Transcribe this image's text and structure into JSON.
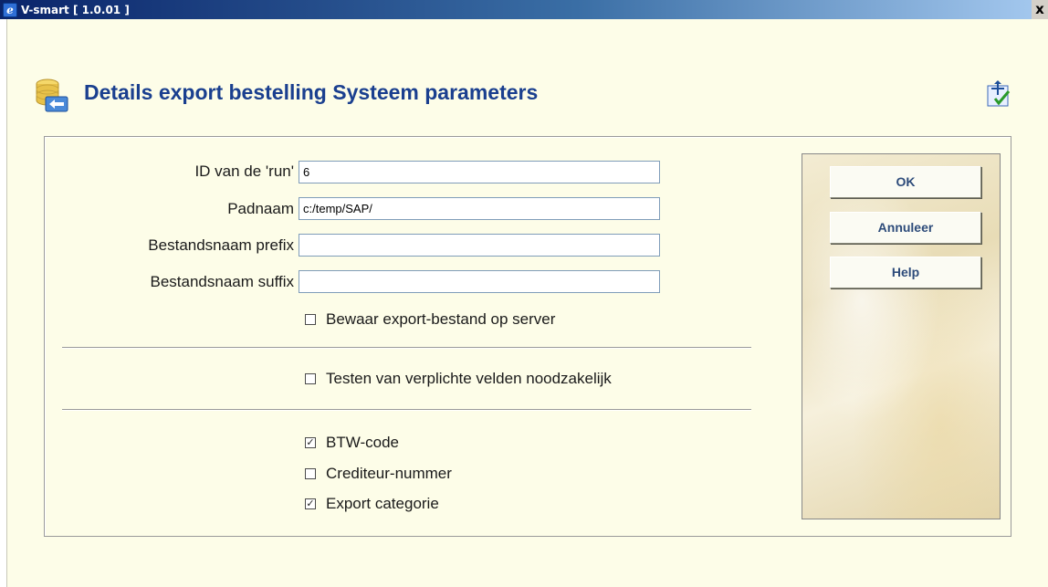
{
  "window": {
    "title": "V-smart [ 1.0.01 ]",
    "close_label": "x"
  },
  "header": {
    "title": "Details export bestelling Systeem parameters"
  },
  "form": {
    "fields": [
      {
        "label": "ID van de 'run'",
        "value": "6",
        "placeholder": ""
      },
      {
        "label": "Padnaam",
        "value": "c:/temp/SAP/",
        "placeholder": ""
      },
      {
        "label": "Bestandsnaam prefix",
        "value": "",
        "placeholder": ""
      },
      {
        "label": "Bestandsnaam suffix",
        "value": "",
        "placeholder": ""
      }
    ],
    "checkboxes": [
      {
        "label": "Bewaar export-bestand op server",
        "checked": false,
        "mark": ""
      },
      {
        "label": "Testen van verplichte velden noodzakelijk",
        "checked": false,
        "mark": ""
      },
      {
        "label": "BTW-code",
        "checked": true,
        "mark": "✓"
      },
      {
        "label": "Crediteur-nummer",
        "checked": false,
        "mark": ""
      },
      {
        "label": "Export categorie",
        "checked": true,
        "mark": "✓"
      }
    ]
  },
  "buttons": {
    "ok": "OK",
    "cancel": "Annuleer",
    "help": "Help"
  },
  "icons": {
    "app": "ie-icon",
    "header": "database-export-icon",
    "help": "help-cursor-icon"
  }
}
